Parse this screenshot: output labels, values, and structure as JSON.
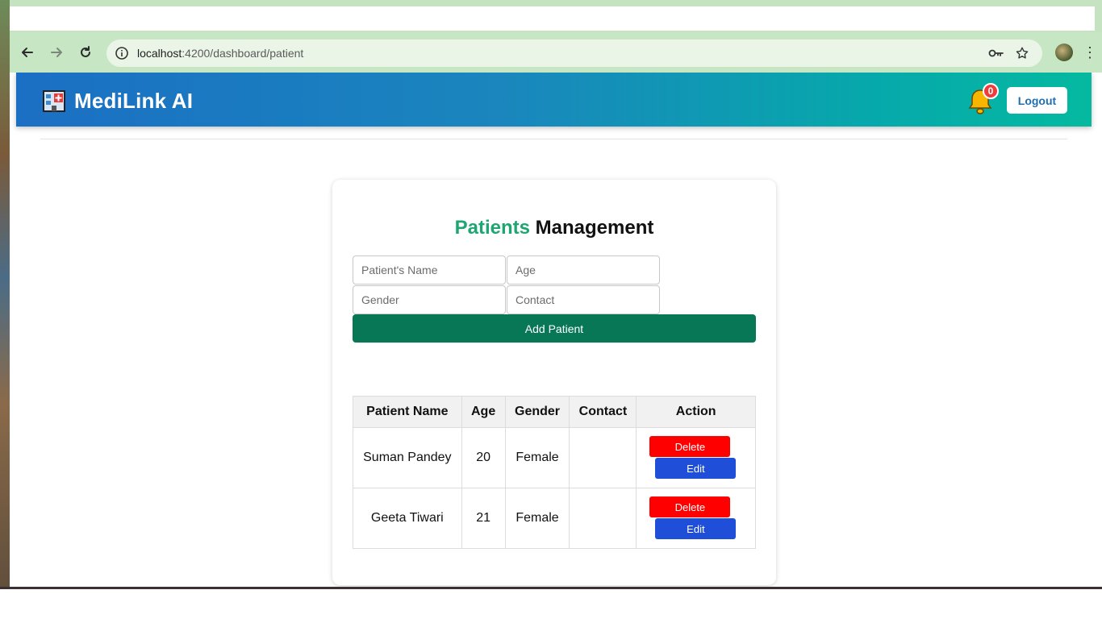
{
  "browser": {
    "url_host": "localhost",
    "url_path": ":4200/dashboard/patient",
    "icons": [
      "back-arrow-icon",
      "forward-arrow-icon",
      "reload-icon",
      "site-info-icon",
      "key-icon",
      "star-icon",
      "menu-icon"
    ]
  },
  "header": {
    "brand": "MediLink AI",
    "notification_count": "0",
    "logout_label": "Logout",
    "colors": {
      "gradient_start": "#1b6fc4",
      "gradient_end": "#05b9a0"
    }
  },
  "patients": {
    "title_accent": "Patients",
    "title_rest": " Management",
    "form": {
      "name_placeholder": "Patient's Name",
      "age_placeholder": "Age",
      "gender_placeholder": "Gender",
      "contact_placeholder": "Contact",
      "add_label": "Add Patient"
    },
    "table": {
      "headers": [
        "Patient Name",
        "Age",
        "Gender",
        "Contact",
        "Action"
      ],
      "rows": [
        {
          "name": "Suman Pandey",
          "age": "20",
          "gender": "Female",
          "contact": "",
          "delete_label": "Delete",
          "edit_label": "Edit"
        },
        {
          "name": "Geeta Tiwari",
          "age": "21",
          "gender": "Female",
          "contact": "",
          "delete_label": "Delete",
          "edit_label": "Edit"
        }
      ]
    },
    "colors": {
      "accent": "#1ea571",
      "add_button": "#087756",
      "delete": "#ff0000",
      "edit": "#1f4fd8"
    }
  }
}
